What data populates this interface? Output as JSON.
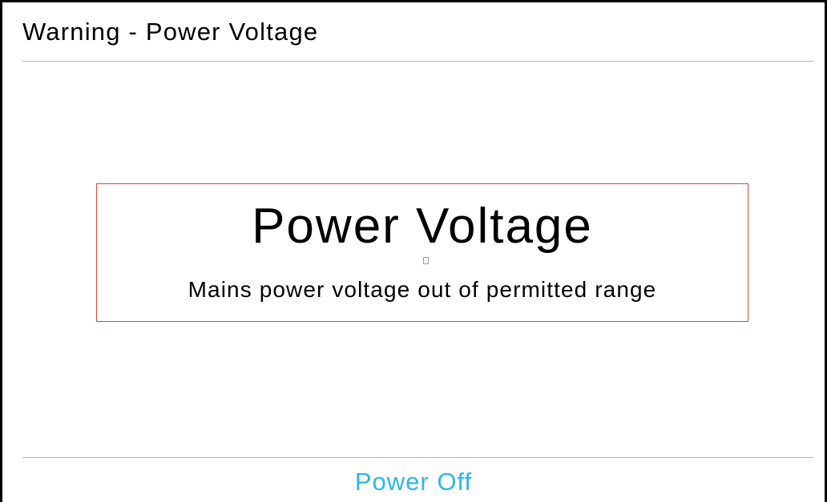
{
  "window": {
    "title": "Warning - Power Voltage"
  },
  "alert": {
    "heading": "Power Voltage",
    "message": "Mains power voltage out of permitted range",
    "border_color": "#e0443a",
    "glyph_icon": "missing-glyph-icon"
  },
  "actions": {
    "power_off_label": "Power Off",
    "accent_color": "#2cb7e8"
  }
}
